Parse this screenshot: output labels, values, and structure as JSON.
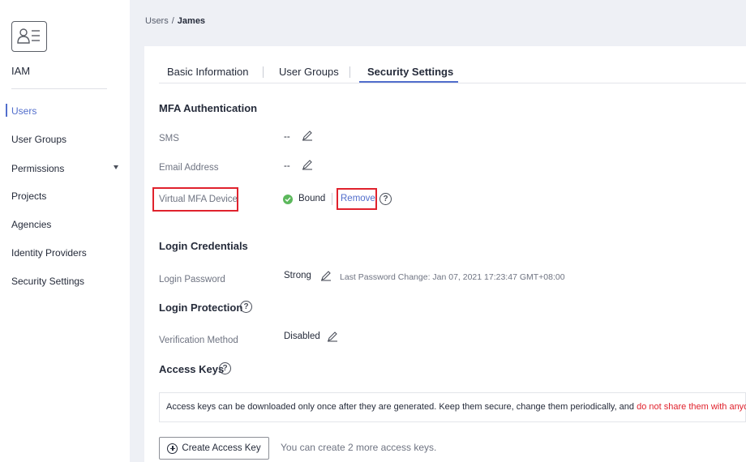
{
  "app": {
    "name": "IAM",
    "logo_icon": "user-card-icon"
  },
  "sidebar": {
    "items": [
      {
        "label": "Users",
        "active": true
      },
      {
        "label": "User Groups"
      },
      {
        "label": "Permissions",
        "expandable": true
      },
      {
        "label": "Projects"
      },
      {
        "label": "Agencies"
      },
      {
        "label": "Identity Providers"
      },
      {
        "label": "Security Settings"
      }
    ]
  },
  "breadcrumb": {
    "parent": "Users",
    "separator": "/",
    "current": "James"
  },
  "tabs": [
    {
      "label": "Basic Information"
    },
    {
      "label": "User Groups"
    },
    {
      "label": "Security Settings",
      "active": true
    }
  ],
  "mfa": {
    "title": "MFA Authentication",
    "sms_label": "SMS",
    "sms_value": "--",
    "email_label": "Email Address",
    "email_value": "--",
    "device_label": "Virtual MFA Device",
    "device_status": "Bound",
    "device_action": "Remove"
  },
  "login_credentials": {
    "title": "Login Credentials",
    "password_label": "Login Password",
    "password_strength": "Strong",
    "last_change": "Last Password Change: Jan 07, 2021 17:23:47 GMT+08:00"
  },
  "login_protection": {
    "title": "Login Protection",
    "method_label": "Verification Method",
    "method_value": "Disabled"
  },
  "access_keys": {
    "title": "Access Keys",
    "notice_main": "Access keys can be downloaded only once after they are generated. Keep them secure, change them periodically, and ",
    "notice_warn": "do not share them with anyone.",
    "create_button": "Create Access Key",
    "hint": "You can create 2 more access keys."
  },
  "colors": {
    "accent": "#526ecc",
    "highlight_red": "#e0222d",
    "status_green": "#5cb85c"
  }
}
